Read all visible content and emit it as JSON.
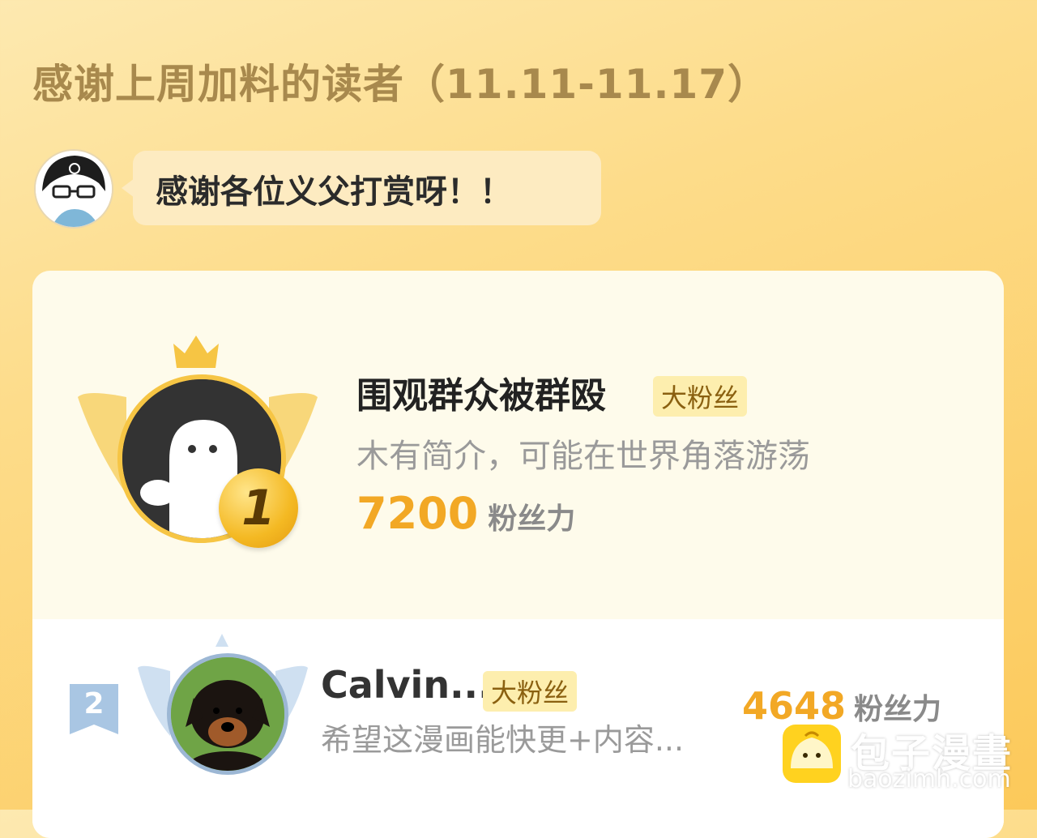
{
  "header": {
    "title": "感谢上周加料的读者（11.11-11.17）"
  },
  "author": {
    "avatar_icon": "author-avatar-icon",
    "message": "感谢各位义父打赏呀！！"
  },
  "ranking": [
    {
      "rank": "1",
      "name": "围观群众被群殴",
      "badge": "大粉丝",
      "bio": "木有简介，可能在世界角落游荡",
      "fans_value": "7200",
      "fans_unit": "粉丝力",
      "accent": "#f2a825"
    },
    {
      "rank": "2",
      "name": "Calvin...",
      "badge": "大粉丝",
      "bio": "希望这漫画能快更+内容...",
      "fans_value": "4648",
      "fans_unit": "粉丝力",
      "accent": "#a9c6e3"
    }
  ],
  "watermark": {
    "title": "包子漫畫",
    "url": "baozimh.com"
  },
  "colors": {
    "gold": "#f2a825",
    "title": "#a8894d",
    "badge_bg": "#fdeeae"
  }
}
